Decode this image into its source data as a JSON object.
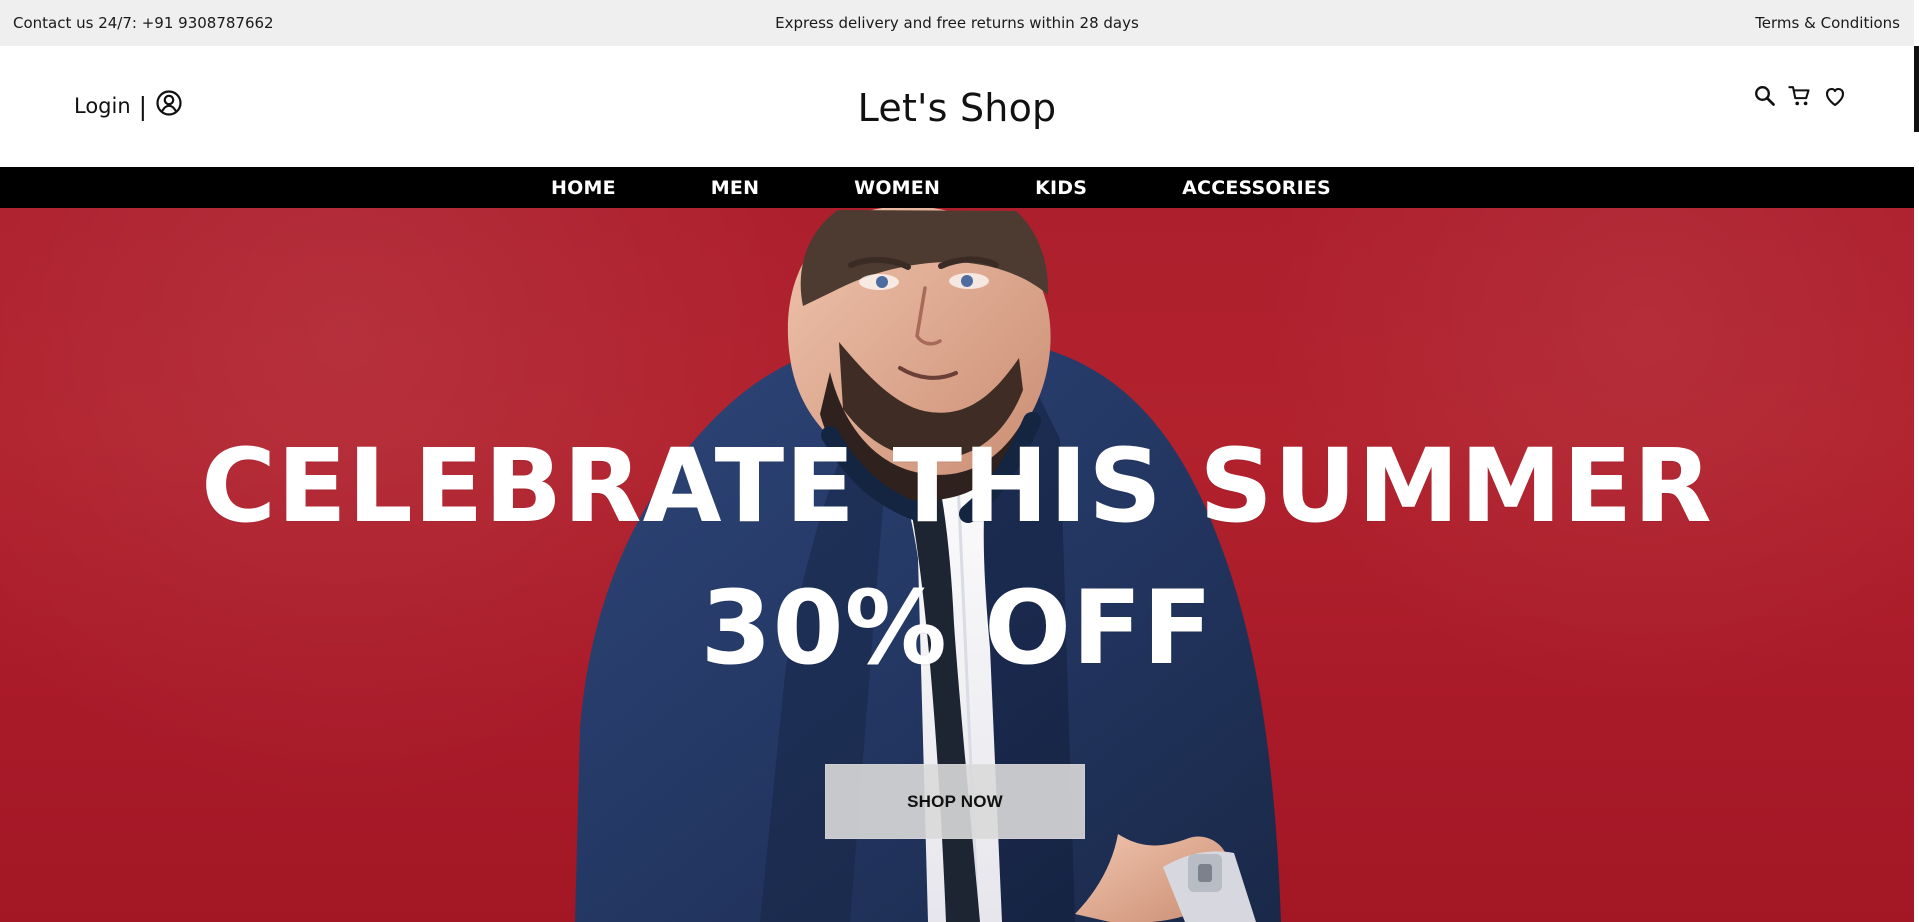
{
  "topbar": {
    "contact": "Contact us 24/7: +91 9308787662",
    "message": "Express delivery and free returns within 28 days",
    "terms": "Terms & Conditions"
  },
  "header": {
    "login_label": "Login",
    "separator": "|",
    "brand": "Let's Shop",
    "icons": [
      "user-icon",
      "search-icon",
      "cart-icon",
      "heart-icon"
    ]
  },
  "nav": {
    "items": [
      "HOME",
      "MEN",
      "WOMEN",
      "KIDS",
      "ACCESSORIES"
    ]
  },
  "hero": {
    "headline": "CELEBRATE THIS SUMMER",
    "offer": "30% OFF",
    "cta": "SHOP NOW"
  },
  "colors": {
    "topbar_bg": "#efefef",
    "nav_bg": "#000000",
    "hero_bg": "#b1222d",
    "button_bg": "#d9d9d9"
  }
}
